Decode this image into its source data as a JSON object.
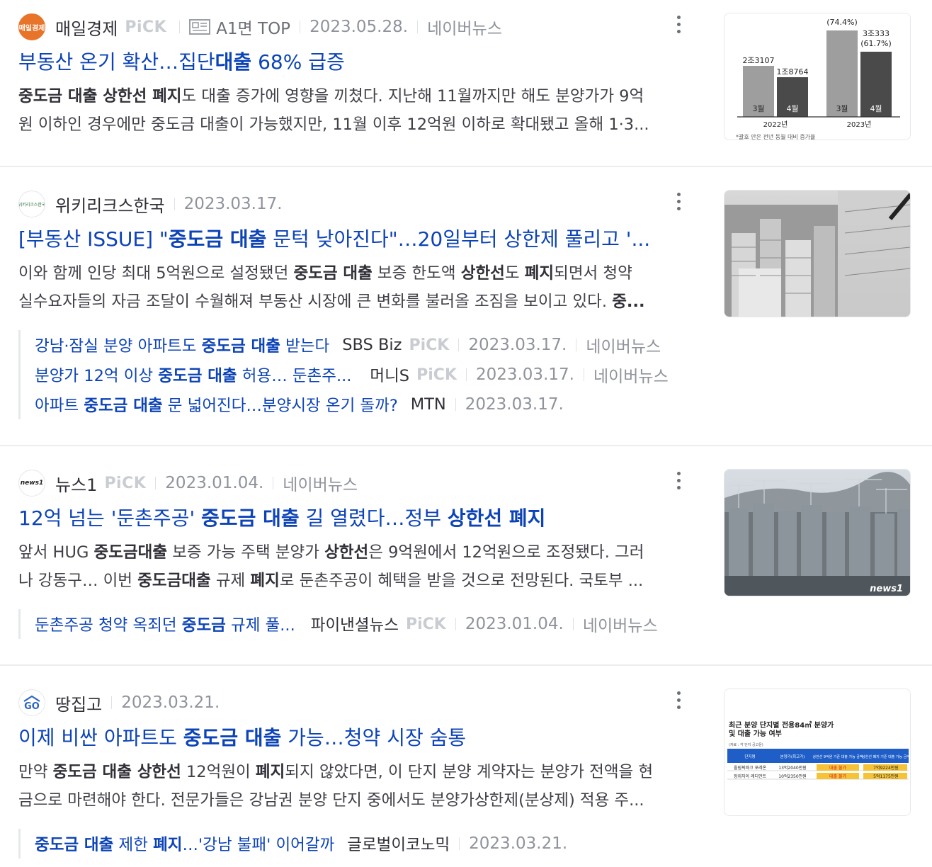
{
  "items": [
    {
      "press": "매일경제",
      "pick": "PiCK",
      "section": "A1면 TOP",
      "date": "2023.05.28.",
      "naver": "네이버뉴스",
      "title_pre": "부동산 온기 확산…집단",
      "title_bold": "대출",
      "title_post": " 68% 급증",
      "desc1_b1": "중도금 대출 상한선 폐지",
      "desc1_t1": "도 대출 증가에 영향을 끼쳤다. 지난해 11월까지만 해도 분양가가 9억",
      "desc2_t1": "원 이하인 경우에만 중도금 대출이 가능했지만, 11월 이후 12억원 이하로 확대됐고 올해 1·3...",
      "logo_text": "매일경제"
    },
    {
      "press": "위키리크스한국",
      "date": "2023.03.17.",
      "title_pre": "[부동산 ISSUE] \"",
      "title_bold": "중도금 대출",
      "title_post": " 문턱 낮아진다\"…20일부터 상한제 풀리고 '...",
      "desc1_t1": "이와 함께 인당 최대 5억원으로 설정됐던 ",
      "desc1_b1": "중도금 대출",
      "desc1_t2": " 보증 한도액 ",
      "desc1_b2": "상한선",
      "desc1_t3": "도 ",
      "desc1_b3": "폐지",
      "desc1_t4": "되면서 청약",
      "desc2_t1": "실수요자들의 자금 조달이 수월해져 부동산 시장에 큰 변화를 불러올 조짐을 보이고 있다. ",
      "desc2_b1": "중...",
      "logo_text": "위키리크스한국",
      "related": [
        {
          "pre": "강남·잠실 분양 아파트도 ",
          "bold": "중도금 대출",
          "post": " 받는다",
          "press": "SBS Biz",
          "pick": "PiCK",
          "date": "2023.03.17.",
          "naver": "네이버뉴스"
        },
        {
          "pre": "분양가 12억 이상 ",
          "bold": "중도금 대출",
          "post": " 허용… 둔촌주...",
          "press": "머니S",
          "pick": "PiCK",
          "date": "2023.03.17.",
          "naver": "네이버뉴스"
        },
        {
          "pre": "아파트 ",
          "bold": "중도금 대출",
          "post": " 문 넓어진다…분양시장 온기 돌까?",
          "press": "MTN",
          "date": "2023.03.17."
        }
      ]
    },
    {
      "press": "뉴스1",
      "pick": "PiCK",
      "date": "2023.01.04.",
      "naver": "네이버뉴스",
      "title_pre": "12억 넘는 '둔촌주공' ",
      "title_bold": "중도금 대출",
      "title_post": " 길 열렸다…정부 ",
      "title_bold2": "상한선 폐지",
      "desc1_t1": "앞서 HUG ",
      "desc1_b1": "중도금대출",
      "desc1_t2": " 보증 가능 주택 분양가 ",
      "desc1_b2": "상한선",
      "desc1_t3": "은 9억원에서 12억원으로 조정됐다. 그러",
      "desc2_t1": "나 강동구… 이번 ",
      "desc2_b1": "중도금대출",
      "desc2_t2": " 규제 ",
      "desc2_b2": "폐지",
      "desc2_t3": "로 둔촌주공이 혜택을 받을 것으로 전망된다. 국토부 ...",
      "logo_text": "news1",
      "thumb_watermark": "news1",
      "related": [
        {
          "pre": "둔촌주공 청약 옥죄던 ",
          "bold": "중도금",
          "post": " 규제 풀...",
          "press": "파이낸셜뉴스",
          "pick": "PiCK",
          "date": "2023.01.04.",
          "naver": "네이버뉴스"
        }
      ]
    },
    {
      "press": "땅집고",
      "date": "2023.03.21.",
      "title_pre": "이제 비싼 아파트도 ",
      "title_bold": "중도금 대출",
      "title_post": " 가능…청약 시장 숨통",
      "desc1_t1": "만약 ",
      "desc1_b1": "중도금 대출 상한선",
      "desc1_t2": " 12억원이 ",
      "desc1_b2": "폐지",
      "desc1_t3": "되지 않았다면, 이 단지 분양 계약자는 분양가 전액을 현",
      "desc2_t1": "금으로 마련해야 한다. 전문가들은 강남권 분양 단지 중에서도 분양가상한제(분상제) 적용 주...",
      "logo_text": "GO",
      "related": [
        {
          "pre": "",
          "bold": "중도금 대출",
          "post": " 제한 ",
          "bold2": "폐지",
          "post2": "…'강남 불패' 이어갈까",
          "press": "글로벌이코노믹",
          "date": "2023.03.21."
        }
      ]
    }
  ],
  "thumb1": {
    "labels_top": [
      "(74.4%)",
      "3조333",
      "(61.7%)"
    ],
    "bar_labels": [
      "2조3107",
      "1조8764"
    ],
    "months": [
      "3월",
      "4월",
      "3월",
      "4월"
    ],
    "years": [
      "2022년",
      "2023년"
    ],
    "note": "*괄호 안은 전년 동월 대비 증가율"
  },
  "thumb4": {
    "title1": "최근 분양 단지별 전용84㎡ 분양가",
    "title2": "및 대출 가능 여부",
    "source": "(자료 : 각 단지 공고문)",
    "headers": [
      "단지명",
      "분양가(최고가)",
      "상한선 9억원 기준 대출 가능 금액",
      "상한선 폐지 기준 대출 가능 금액"
    ],
    "rows": [
      [
        "올림픽파크 포레온",
        "13억2040만원",
        "대출 불가",
        "7억9224만원"
      ],
      [
        "장위자이 레디언트",
        "10억2350만원",
        "대출 불가",
        "5억1175만원"
      ]
    ]
  }
}
